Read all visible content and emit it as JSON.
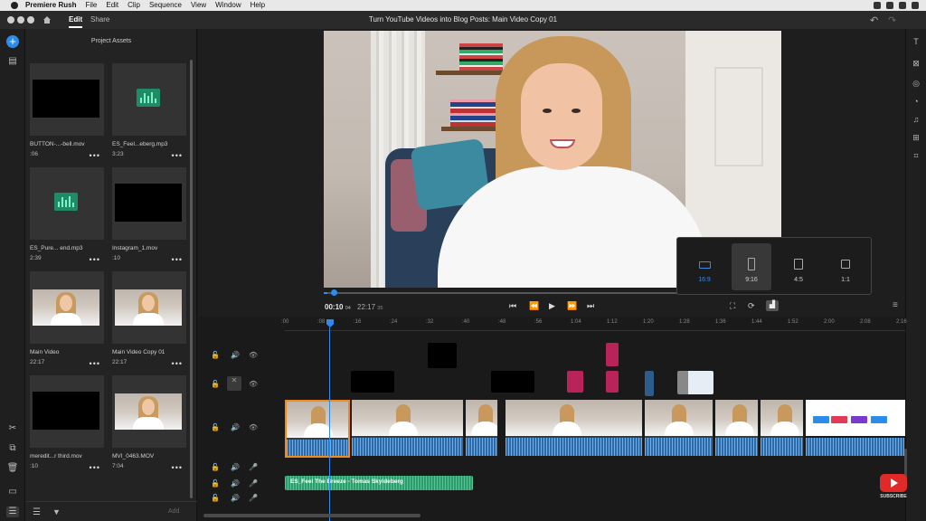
{
  "menubar": {
    "app_name": "Premiere Rush",
    "items": [
      "File",
      "Edit",
      "Clip",
      "Sequence",
      "View",
      "Window",
      "Help"
    ]
  },
  "titlebar": {
    "tabs": [
      {
        "label": "Edit",
        "active": true
      },
      {
        "label": "Share",
        "active": false
      }
    ],
    "document_title": "Turn YouTube Videos into Blog Posts: Main Video Copy 01"
  },
  "assets": {
    "title": "Project Assets",
    "items": [
      {
        "name": "BUTTON-...-bell.mov",
        "duration": ":06",
        "kind": "black"
      },
      {
        "name": "ES_Feel...eberg.mp3",
        "duration": "3:23",
        "kind": "audio"
      },
      {
        "name": "ES_Pure... end.mp3",
        "duration": "2:39",
        "kind": "audio"
      },
      {
        "name": "Instagram_1.mov",
        "duration": ":10",
        "kind": "black"
      },
      {
        "name": "Main Video",
        "duration": "22:17",
        "kind": "video"
      },
      {
        "name": "Main Video Copy 01",
        "duration": "22:17",
        "kind": "video"
      },
      {
        "name": "meredit...r third.mov",
        "duration": ":10",
        "kind": "black"
      },
      {
        "name": "MVI_0463.MOV",
        "duration": "7:04",
        "kind": "video"
      }
    ],
    "footer_add": "Add"
  },
  "player": {
    "timecode": "00:10",
    "timecode_frames": "04",
    "duration": "22:17",
    "duration_frames": "35",
    "progress": 0.0075
  },
  "aspect_ratios": [
    {
      "label": "16:9",
      "active": true,
      "selected": false
    },
    {
      "label": "9:16",
      "active": false,
      "selected": true
    },
    {
      "label": "4:5",
      "active": false,
      "selected": false
    },
    {
      "label": "1:1",
      "active": false,
      "selected": false
    }
  ],
  "timeline": {
    "ruler": [
      ":00",
      ":08",
      ":16",
      ":24",
      ":32",
      ":40",
      ":48",
      ":56",
      "1:04",
      "1:12",
      "1:20",
      "1:28",
      "1:36",
      "1:44",
      "1:52",
      "2:00",
      "2:08",
      "2:16"
    ],
    "music_clip_label": "ES_Feel The Breeze - Tomas Skyldeberg"
  },
  "youtube": {
    "subscribe": "SUBSCRIBE"
  },
  "colors": {
    "accent": "#2d8ceb",
    "selection": "#f08a1c",
    "audio_green": "#2f9a6c",
    "marker_pink": "#b8245a"
  }
}
